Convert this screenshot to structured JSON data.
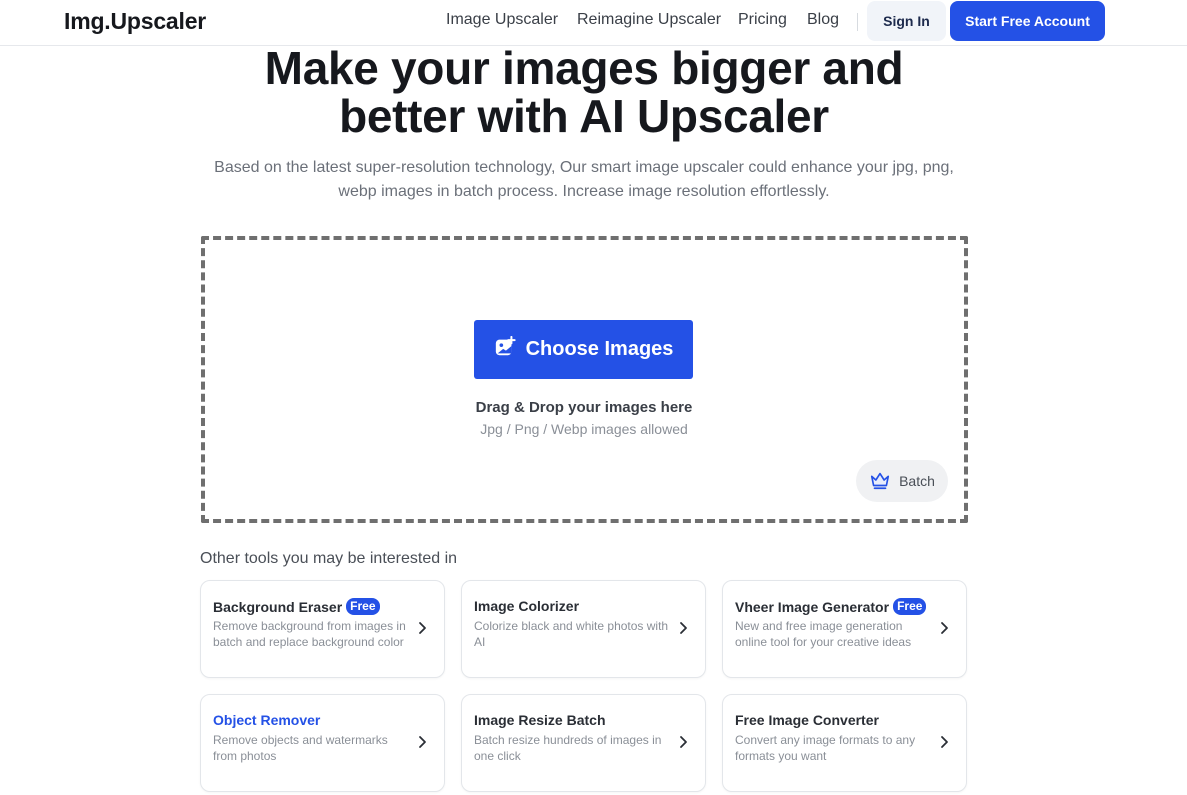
{
  "header": {
    "logo": "Img.Upscaler",
    "nav": [
      "Image Upscaler",
      "Reimagine Upscaler",
      "Pricing",
      "Blog"
    ],
    "signin_label": "Sign In",
    "start_label": "Start Free Account"
  },
  "hero": {
    "title_line1": "Make your images bigger and",
    "title_line2": "better with AI Upscaler",
    "subtitle_line1": "Based on the latest super-resolution technology, Our smart image upscaler could enhance your jpg, png,",
    "subtitle_line2": "webp images in batch process. Increase image resolution effortlessly."
  },
  "upload": {
    "choose_label": "Choose Images",
    "drag_text": "Drag & Drop your images here",
    "allowed_text": "Jpg / Png / Webp images allowed",
    "batch_label": "Batch"
  },
  "tools": {
    "title": "Other tools you may be interested in",
    "cards": [
      {
        "title": "Background Eraser",
        "badge": "Free",
        "desc": "Remove background from images in batch and replace background color"
      },
      {
        "title": "Image Colorizer",
        "badge": "",
        "desc": "Colorize black and white photos with AI"
      },
      {
        "title": "Vheer Image Generator",
        "badge": "Free",
        "desc": "New and free image generation online tool for your creative ideas"
      },
      {
        "title": "Object Remover",
        "badge": "",
        "desc": "Remove objects and watermarks from photos"
      },
      {
        "title": "Image Resize Batch",
        "badge": "",
        "desc": "Batch resize hundreds of images in one click"
      },
      {
        "title": "Free Image Converter",
        "badge": "",
        "desc": "Convert any image formats to any formats you want"
      }
    ]
  },
  "colors": {
    "accent": "#2451e6",
    "title_text": "#16181d",
    "muted_text": "#8a8f97"
  },
  "icons": [
    "add-image-icon",
    "crown-icon",
    "chevron-right-icon"
  ]
}
